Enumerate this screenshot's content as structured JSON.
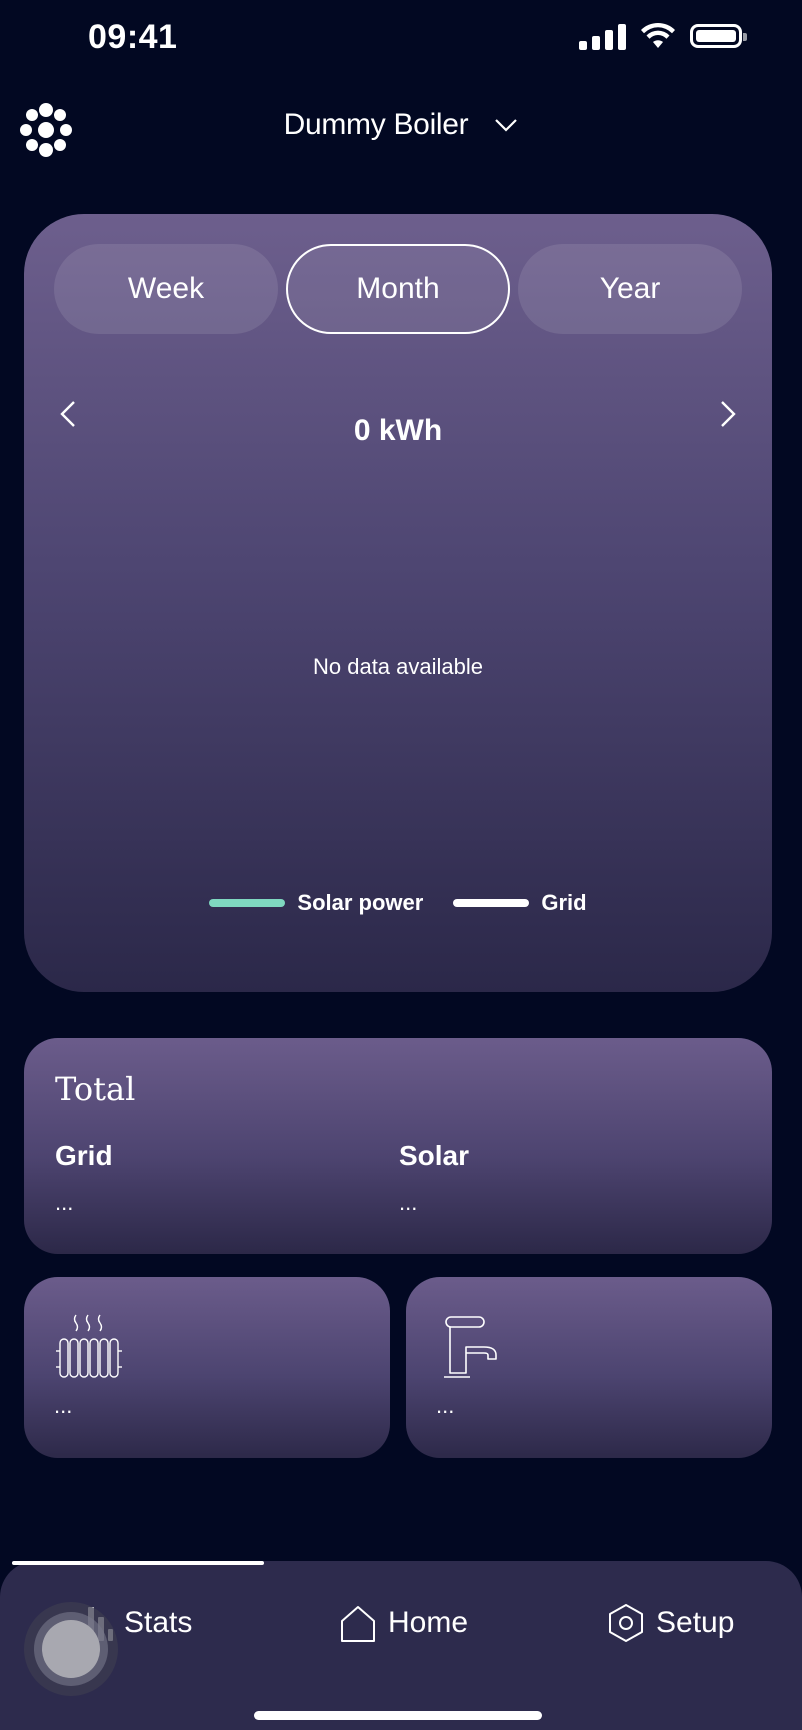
{
  "status_bar": {
    "time": "09:41"
  },
  "header": {
    "device_name": "Dummy Boiler"
  },
  "period_tabs": [
    {
      "label": "Week",
      "active": false
    },
    {
      "label": "Month",
      "active": true
    },
    {
      "label": "Year",
      "active": false
    }
  ],
  "chart": {
    "total": "0 kWh",
    "empty_message": "No data available",
    "legend": [
      {
        "label": "Solar power",
        "color": "#7fd8c0"
      },
      {
        "label": "Grid",
        "color": "#ffffff"
      }
    ]
  },
  "chart_data": {
    "type": "line",
    "series": [
      {
        "name": "Solar power",
        "values": []
      },
      {
        "name": "Grid",
        "values": []
      }
    ],
    "title": "0 kWh"
  },
  "totals": {
    "title": "Total",
    "grid_label": "Grid",
    "grid_value": "...",
    "solar_label": "Solar",
    "solar_value": "..."
  },
  "tiles": {
    "heating_value": "...",
    "water_value": "..."
  },
  "bottom_nav": [
    {
      "label": "Stats",
      "icon": "stats-icon",
      "active": true
    },
    {
      "label": "Home",
      "icon": "home-icon",
      "active": false
    },
    {
      "label": "Setup",
      "icon": "setup-icon",
      "active": false
    }
  ],
  "colors": {
    "background": "#020822",
    "card_top": "#6d5f8d",
    "card_bottom": "#2b2849",
    "nav_bar": "#2d2b4d",
    "solar_accent": "#7fd8c0"
  }
}
